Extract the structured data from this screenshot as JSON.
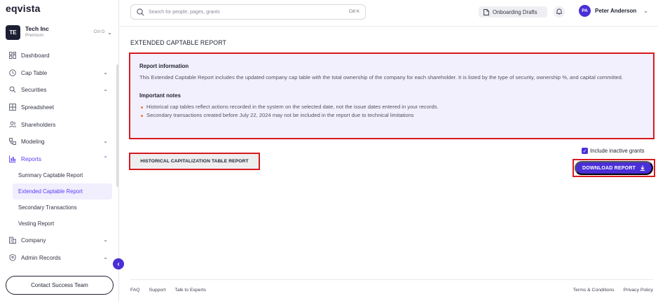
{
  "app": {
    "logo": "eqvista"
  },
  "company": {
    "initials": "TE",
    "name": "Tech Inc",
    "plan": "Premium",
    "shortcut": "Ctrl O"
  },
  "sidebar": {
    "items": [
      {
        "label": "Dashboard",
        "icon": "dashboard-icon"
      },
      {
        "label": "Cap Table",
        "icon": "clock-icon"
      },
      {
        "label": "Securities",
        "icon": "search-icon"
      },
      {
        "label": "Spreadsheet",
        "icon": "grid-icon"
      },
      {
        "label": "Shareholders",
        "icon": "users-icon"
      },
      {
        "label": "Modeling",
        "icon": "modeling-icon"
      },
      {
        "label": "Reports",
        "icon": "chart-icon"
      }
    ],
    "report_subitems": [
      {
        "label": "Summary Captable Report"
      },
      {
        "label": "Extended Captable Report"
      },
      {
        "label": "Secondary Transactions"
      },
      {
        "label": "Vesting Report"
      }
    ],
    "bottom_items": [
      {
        "label": "Company",
        "icon": "company-icon"
      },
      {
        "label": "Admin Records",
        "icon": "shield-icon"
      }
    ],
    "contact_label": "Contact Success Team"
  },
  "header": {
    "search_placeholder": "Search for people, pages, grants",
    "search_shortcut": "Ctrl K",
    "drafts_label": "Onboarding Drafts",
    "user_initials": "PA",
    "user_name": "Peter Anderson"
  },
  "main": {
    "title": "EXTENDED CAPTABLE REPORT",
    "info_heading": "Report information",
    "info_text": "This Extended Captable Report includes the updated company cap table with the total ownership of the company for each shareholder. It is listed by the type of security, ownership %, and capital committed.",
    "notes_heading": "Important notes",
    "notes": [
      "Historical cap tables reflect actions recorded in the system on the selected date, not the issue dates entered in your records.",
      "Secondary transactions created before July 22, 2024 may not be included in the report due to technical limitations"
    ],
    "historical_button": "HISTORICAL CAPITALIZATION TABLE REPORT",
    "include_inactive_label": "Include inactive grants",
    "download_button": "DOWNLOAD REPORT"
  },
  "footer": {
    "left_links": [
      "FAQ",
      "Support",
      "Talk to Experts"
    ],
    "right_links": [
      "Terms & Conditions",
      "Privacy Policy"
    ]
  },
  "colors": {
    "accent": "#4a2fd6",
    "highlight_border": "#d71920",
    "info_bg": "#f3f0fd"
  }
}
